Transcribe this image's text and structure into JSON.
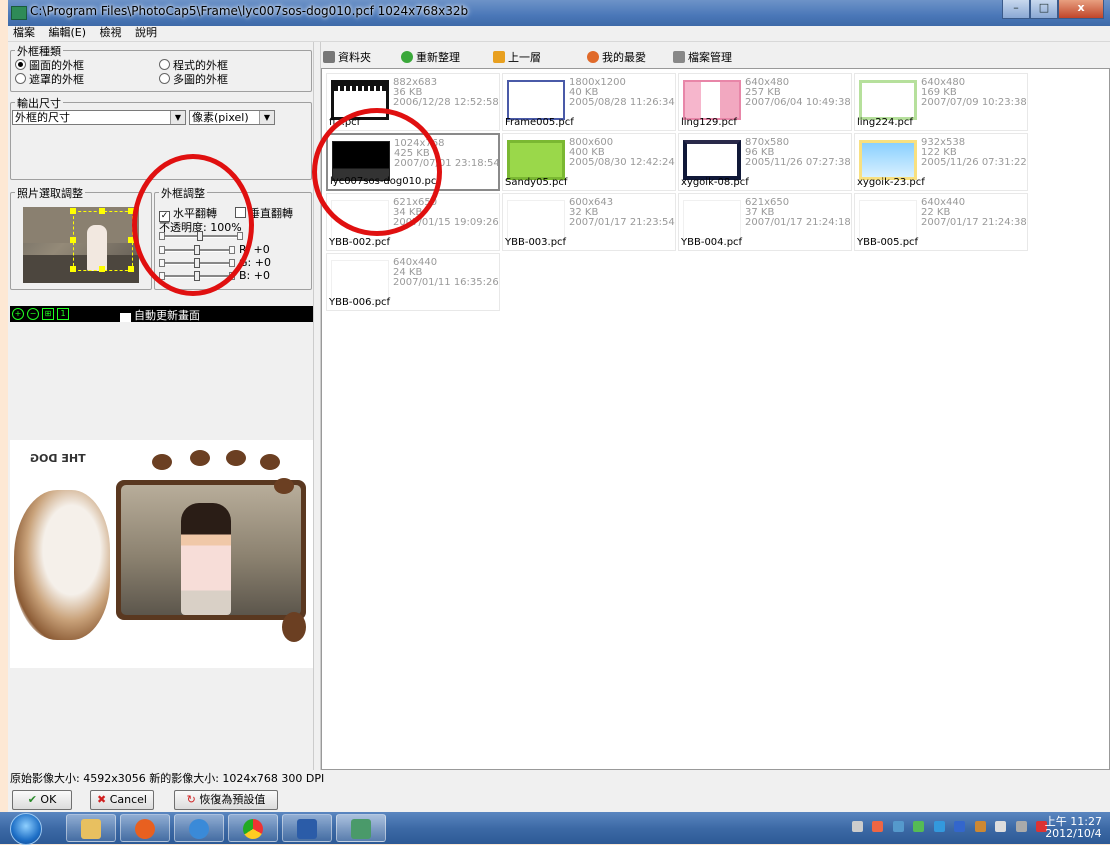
{
  "window": {
    "title": "C:\\Program Files\\PhotoCap5\\Frame\\lyc007sos-dog010.pcf  1024x768x32b",
    "controls": {
      "min": "–",
      "max": "□",
      "close": "x"
    }
  },
  "menu": [
    "檔案",
    "編輯(E)",
    "檢視",
    "說明"
  ],
  "frame_type": {
    "label": "外框種類",
    "options": [
      {
        "label": "圖面的外框",
        "selected": true
      },
      {
        "label": "程式的外框",
        "selected": false
      },
      {
        "label": "遮罩的外框",
        "selected": false
      },
      {
        "label": "多圖的外框",
        "selected": false
      }
    ]
  },
  "output_size": {
    "label": "輸出尺寸",
    "size_value": "外框的尺寸",
    "unit_value": "像素(pixel)"
  },
  "photo_adjust": {
    "label": "照片選取調整"
  },
  "frame_adjust": {
    "label": "外框調整",
    "horizontal_flip": "水平翻轉",
    "horizontal_flip_checked": true,
    "vertical_flip": "垂直翻轉",
    "vertical_flip_checked": false,
    "opacity_label": "不透明度: 100%",
    "r_label": "R: +0",
    "g_label": "G: +0",
    "b_label": "B: +0",
    "opacity": 1.0,
    "r": 0,
    "g": 0,
    "b": 0
  },
  "preview_toolbar": {
    "auto_update": "自動更新畫面",
    "auto_update_checked": true
  },
  "status_bar": {
    "text": "原始影像大小: 4592x3056   新的影像大小: 1024x768 300 DPI"
  },
  "buttons": {
    "ok": "OK",
    "cancel": "Cancel",
    "reset": "恢復為預設值"
  },
  "file_toolbar": {
    "folder": "資料夾",
    "refresh": "重新整理",
    "up": "上一層",
    "favorites": "我的最愛",
    "manage": "檔案管理"
  },
  "files": [
    {
      "name": "fi...pcf",
      "size": "882x683",
      "kb": "36 KB",
      "date": "2006/12/28 12:52:58",
      "selected": false,
      "thumb": "film"
    },
    {
      "name": "Frame005.pcf",
      "size": "1800x1200",
      "kb": "40 KB",
      "date": "2005/08/28 11:26:34",
      "selected": false,
      "thumb": "blue-frame"
    },
    {
      "name": "ling129.pcf",
      "size": "640x480",
      "kb": "257 KB",
      "date": "2007/06/04 10:49:38",
      "selected": false,
      "thumb": "pink"
    },
    {
      "name": "ling224.pcf",
      "size": "640x480",
      "kb": "169 KB",
      "date": "2007/07/09 10:23:38",
      "selected": false,
      "thumb": "green-bunny"
    },
    {
      "name": "lyc007sos-dog010.pcf",
      "size": "1024x768",
      "kb": "425 KB",
      "date": "2007/07/01 23:18:54",
      "selected": true,
      "thumb": "dog"
    },
    {
      "name": "Sandy05.pcf",
      "size": "800x600",
      "kb": "400 KB",
      "date": "2005/08/30 12:42:24",
      "selected": false,
      "thumb": "green"
    },
    {
      "name": "xygoik-08.pcf",
      "size": "870x580",
      "kb": "96 KB",
      "date": "2005/11/26 07:27:38",
      "selected": false,
      "thumb": "dark"
    },
    {
      "name": "xygoik-23.pcf",
      "size": "932x538",
      "kb": "122 KB",
      "date": "2005/11/26 07:31:22",
      "selected": false,
      "thumb": "sky"
    },
    {
      "name": "YBB-002.pcf",
      "size": "621x650",
      "kb": "34 KB",
      "date": "2007/01/15 19:09:26",
      "selected": false,
      "thumb": "paper"
    },
    {
      "name": "YBB-003.pcf",
      "size": "600x643",
      "kb": "32 KB",
      "date": "2007/01/17 21:23:54",
      "selected": false,
      "thumb": "paper"
    },
    {
      "name": "YBB-004.pcf",
      "size": "621x650",
      "kb": "37 KB",
      "date": "2007/01/17 21:24:18",
      "selected": false,
      "thumb": "paper"
    },
    {
      "name": "YBB-005.pcf",
      "size": "640x440",
      "kb": "22 KB",
      "date": "2007/01/17 21:24:38",
      "selected": false,
      "thumb": "paper"
    },
    {
      "name": "YBB-006.pcf",
      "size": "640x440",
      "kb": "24 KB",
      "date": "2007/01/11 16:35:26",
      "selected": false,
      "thumb": "paper"
    }
  ],
  "preview": {
    "logo_text": "THE DOG"
  },
  "taskbar": {
    "apps": [
      "explorer",
      "media",
      "ie",
      "chrome",
      "word",
      "photocap"
    ],
    "clock_time": "上午 11:27",
    "clock_date": "2012/10/4"
  },
  "colors": {
    "annotation_red": "#e01010",
    "title_blue": "#4a77b8"
  }
}
